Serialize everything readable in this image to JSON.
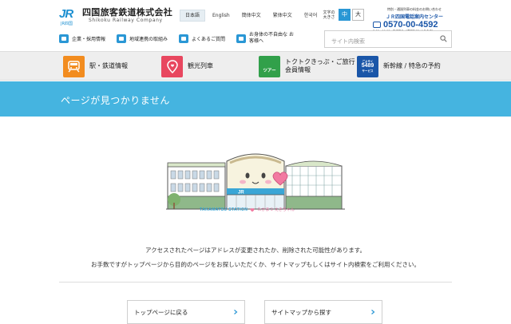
{
  "header": {
    "logo": {
      "mark": "JR",
      "mark_sub": "JR四国",
      "name": "四国旅客鉄道株式会社",
      "name_en": "Shikoku Railway Company"
    },
    "languages": [
      {
        "label": "日本語",
        "active": true
      },
      {
        "label": "English",
        "active": false
      },
      {
        "label": "簡体中文",
        "active": false
      },
      {
        "label": "繁体中文",
        "active": false
      },
      {
        "label": "한국어",
        "active": false
      }
    ],
    "font_size": {
      "label_line1": "文字の",
      "label_line2": "大きさ",
      "medium": "中",
      "large": "大"
    },
    "call_center": {
      "line1": "特別・通過列車の料金のお問い合わせ",
      "line2": "ＪＲ四国電話案内センター",
      "phone": "0570-00-4592",
      "hours": "8:00～19:00　年中無休（通話料がかかります）"
    },
    "subnav": [
      {
        "label": "企業・採用情報",
        "icon": "building-icon"
      },
      {
        "label": "地域連携の取組み",
        "icon": "handshake-icon"
      },
      {
        "label": "よくあるご質問",
        "icon": "faq-icon"
      },
      {
        "label": "お身体の不自由な お客様へ",
        "icon": "accessibility-icon"
      }
    ],
    "search": {
      "placeholder": "サイト内検索",
      "value": ""
    }
  },
  "main_nav": [
    {
      "label": "駅・鉄道情報",
      "icon": "train-icon",
      "color": "#f28c1f"
    },
    {
      "label": "観光列車",
      "icon": "map-pin-icon",
      "color": "#e8475f"
    },
    {
      "label": "トクトクきっぷ・ご旅行 会員情報",
      "icon": "tour-icon",
      "color": "#31a04a",
      "badge": "ツアー"
    },
    {
      "label": "新幹線 / 特急の予約",
      "icon": "5489-icon",
      "color": "#1a56a8",
      "badge_lines": [
        "ごよやく",
        "5489",
        "サービス"
      ]
    }
  ],
  "page": {
    "title": "ページが見つかりません",
    "illustration": {
      "caption_en": "TAKAMATSU STATION",
      "caption_jp": "たかまつ えきちゃん",
      "sign": "JR"
    },
    "message_lines": [
      "アクセスされたページはアドレスが変更されたか、削除された可能性があります。",
      "お手数ですがトップページから目的のページをお探しいただくか、サイトマップもしくはサイト内検索をご利用ください。"
    ],
    "buttons": [
      {
        "label": "トップページに戻る"
      },
      {
        "label": "サイトマップから探す"
      }
    ]
  },
  "colors": {
    "title_band": "#45b4e0",
    "accent": "#2a97d5",
    "jr_blue": "#1b8fd1"
  }
}
